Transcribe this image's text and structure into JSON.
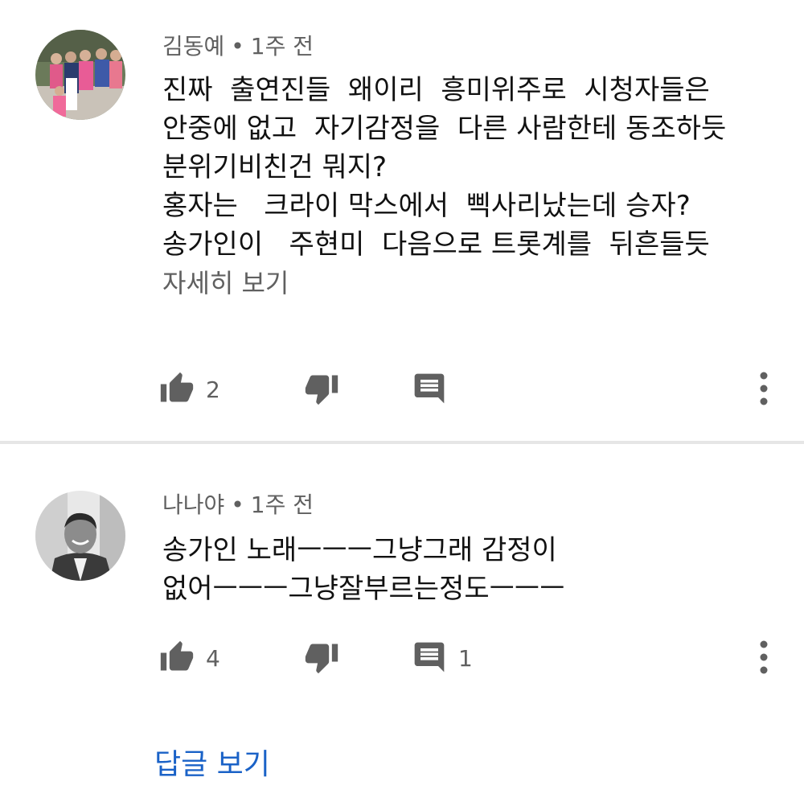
{
  "comments": [
    {
      "author": "김동예",
      "time": "1주 전",
      "text": "진짜  출연진들  왜이리  흥미위주로  시청자들은\n안중에 없고  자기감정을  다른 사람한테 동조하듯\n분위기비친건 뭐지?\n홍자는   크라이 막스에서  삑사리났는데 승자?\n송가인이   주현미  다음으로 트롯계를  뒤흔들듯",
      "read_more": "자세히 보기",
      "likes": "2",
      "replies": ""
    },
    {
      "author": "나나야",
      "time": "1주 전",
      "text": "송가인 노래ㅡㅡㅡ그냥그래 감정이\n없어ㅡㅡㅡ그냥잘부르는정도ㅡㅡㅡ",
      "likes": "4",
      "replies": "1",
      "view_replies": "답글 보기"
    }
  ],
  "separator": "•",
  "icons": {
    "like": "thumbs-up-icon",
    "dislike": "thumbs-down-icon",
    "reply": "comment-icon",
    "more": "more-vertical-icon"
  },
  "colors": {
    "text_primary": "#111111",
    "text_secondary": "#606060",
    "link": "#1a62c7",
    "icon": "#606060",
    "divider": "#e6e6e6"
  }
}
